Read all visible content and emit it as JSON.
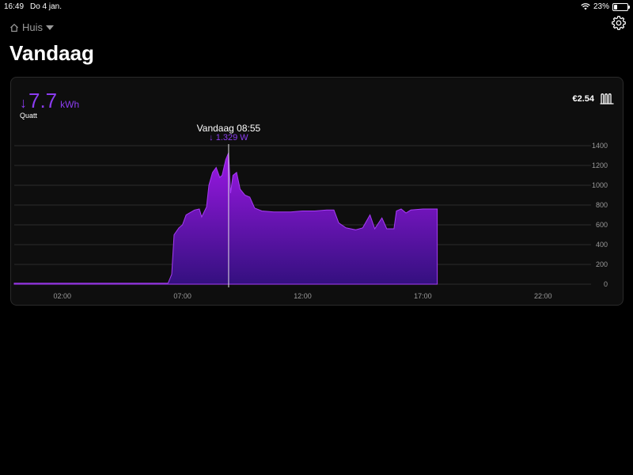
{
  "status": {
    "time": "16:49",
    "date": "Do 4 jan.",
    "battery": "23%",
    "battery_level": 0.23
  },
  "nav": {
    "home_label": "Huis",
    "home_icon": "house-icon",
    "settings_icon": "gear-icon"
  },
  "page": {
    "title": "Vandaag"
  },
  "card": {
    "energy_arrow": "↓",
    "energy_value": "7.7",
    "energy_unit": "kWh",
    "device": "Quatt",
    "cost": "€2.54",
    "device_icon": "radiator-icon"
  },
  "tooltip": {
    "time": "Vandaag 08:55",
    "power": "↓ 1.329 W"
  },
  "chart_data": {
    "type": "area",
    "color": "#8b3cf0",
    "x_ticks": [
      "02:00",
      "07:00",
      "12:00",
      "17:00",
      "22:00"
    ],
    "y_ticks": [
      "0",
      "200",
      "400",
      "600",
      "800",
      "1000",
      "1200",
      "1400"
    ],
    "ylim": [
      0,
      1400
    ],
    "xlim_hours": [
      0,
      24
    ],
    "cursor_hour": 8.92,
    "points": [
      [
        0,
        10
      ],
      [
        6.4,
        10
      ],
      [
        6.55,
        100
      ],
      [
        6.65,
        500
      ],
      [
        6.85,
        570
      ],
      [
        7.0,
        600
      ],
      [
        7.15,
        700
      ],
      [
        7.5,
        750
      ],
      [
        7.7,
        760
      ],
      [
        7.8,
        680
      ],
      [
        8.0,
        780
      ],
      [
        8.1,
        1000
      ],
      [
        8.25,
        1130
      ],
      [
        8.4,
        1180
      ],
      [
        8.55,
        1080
      ],
      [
        8.65,
        1100
      ],
      [
        8.8,
        1260
      ],
      [
        8.92,
        1329
      ],
      [
        9.0,
        920
      ],
      [
        9.1,
        1100
      ],
      [
        9.25,
        1130
      ],
      [
        9.4,
        960
      ],
      [
        9.6,
        900
      ],
      [
        9.8,
        880
      ],
      [
        10.0,
        770
      ],
      [
        10.3,
        740
      ],
      [
        10.8,
        730
      ],
      [
        11.5,
        730
      ],
      [
        12.0,
        740
      ],
      [
        12.5,
        740
      ],
      [
        13.0,
        750
      ],
      [
        13.3,
        750
      ],
      [
        13.5,
        620
      ],
      [
        13.8,
        570
      ],
      [
        14.2,
        550
      ],
      [
        14.5,
        570
      ],
      [
        14.8,
        700
      ],
      [
        15.0,
        560
      ],
      [
        15.3,
        670
      ],
      [
        15.5,
        560
      ],
      [
        15.8,
        560
      ],
      [
        15.9,
        740
      ],
      [
        16.1,
        760
      ],
      [
        16.3,
        720
      ],
      [
        16.5,
        750
      ],
      [
        17.0,
        760
      ],
      [
        17.6,
        760
      ]
    ]
  }
}
